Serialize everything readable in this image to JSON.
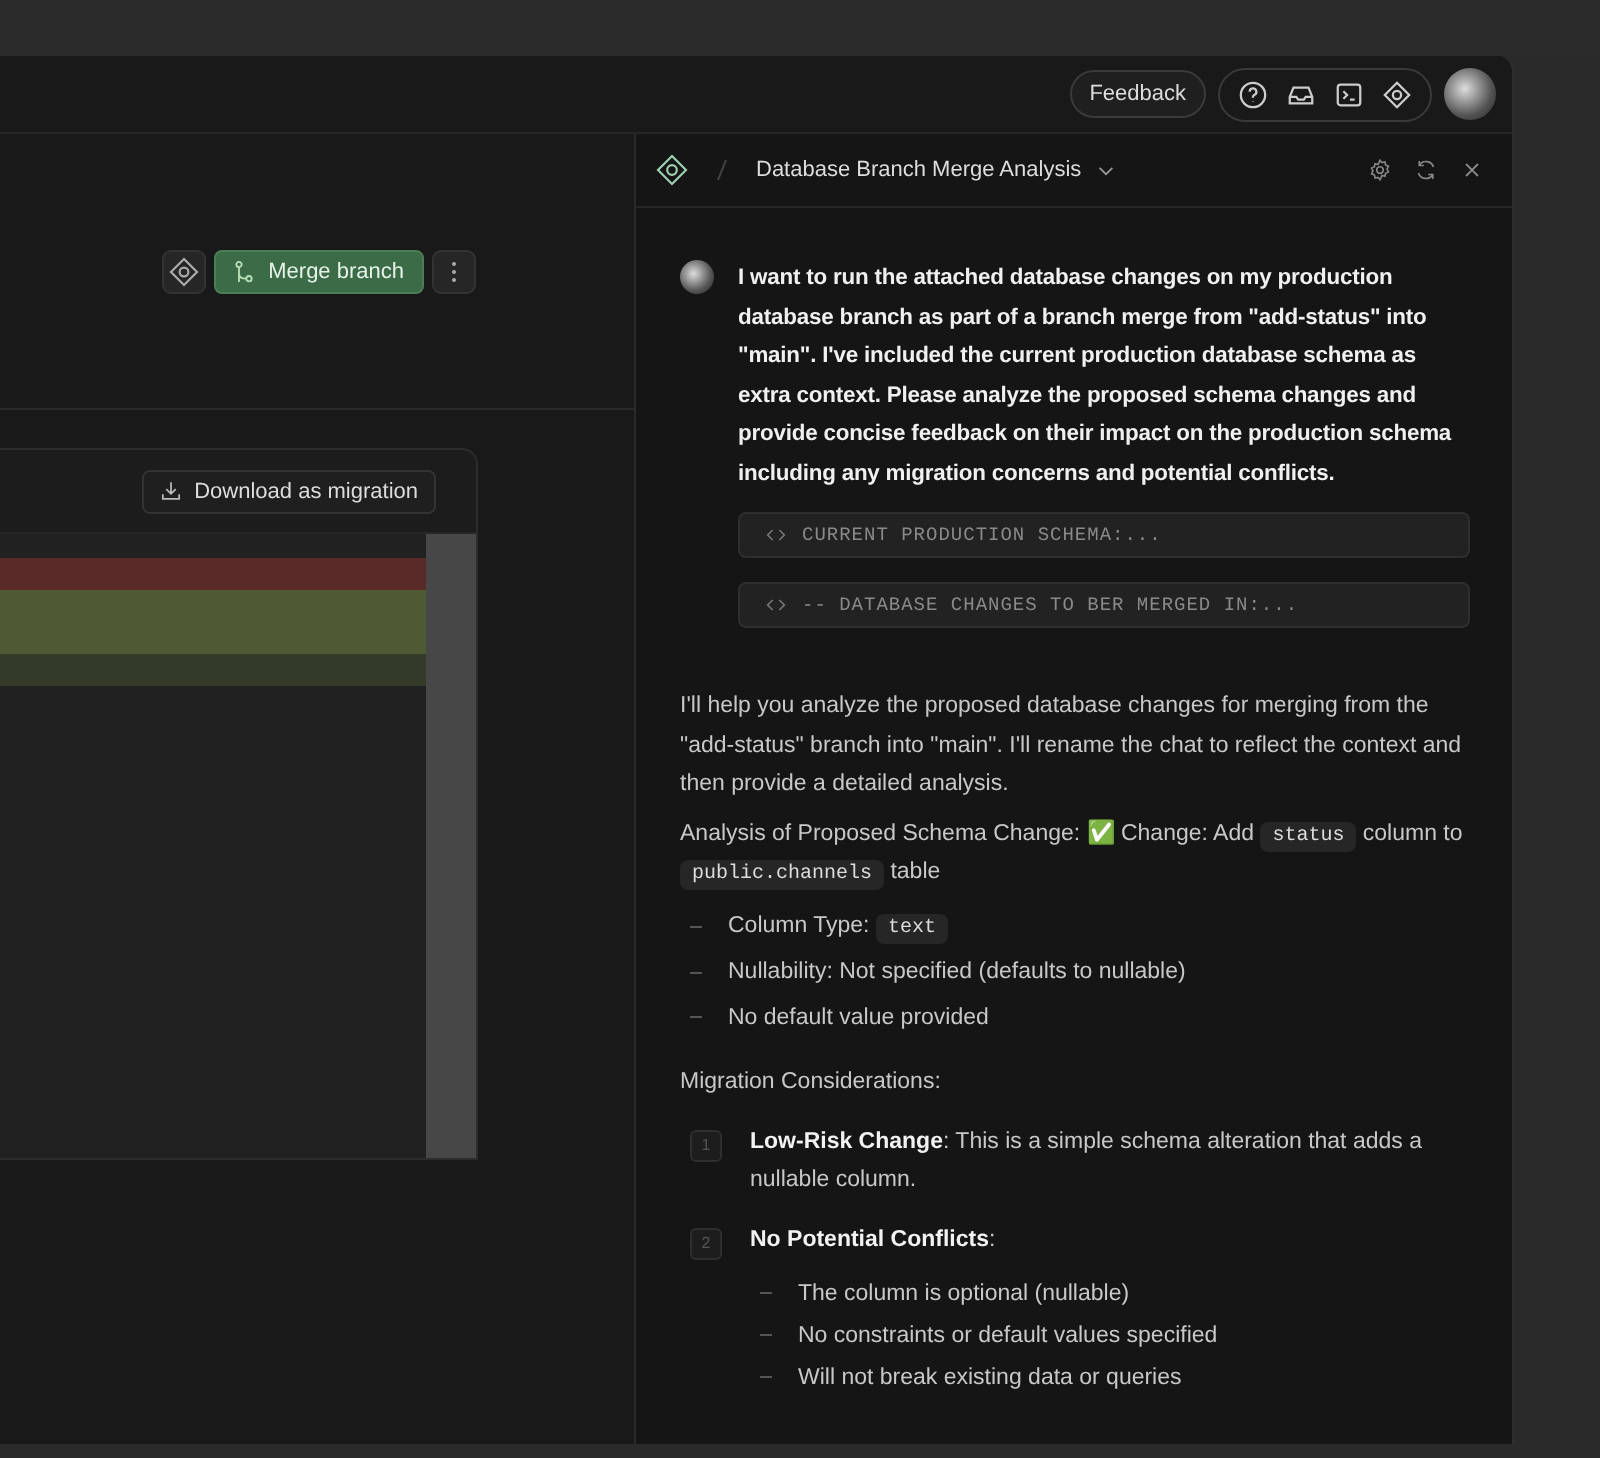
{
  "topbar": {
    "feedback_button": "Feedback"
  },
  "toolbar": {
    "merge_button": "Merge branch"
  },
  "diff_card": {
    "download_button": "Download as migration"
  },
  "chat": {
    "title": "Database Branch Merge Analysis",
    "user_message": {
      "text": "I want to run the attached database changes on my production database branch as part of a branch merge from \"add-status\" into \"main\". I've included the current production database schema as extra context. Please analyze the proposed schema changes and provide concise feedback on their impact on the production schema including any migration concerns and potential conflicts.",
      "attachments": [
        "CURRENT PRODUCTION SCHEMA:...",
        "-- DATABASE CHANGES TO BER MERGED IN:..."
      ]
    },
    "reply": {
      "intro": "I'll help you analyze the proposed database changes for merging from the \"add-status\" branch into \"main\". I'll rename the chat to reflect the context and then provide a detailed analysis.",
      "analysis": [
        {
          "kind": "text",
          "text": "Analysis of Proposed Schema Change: ✅ Change: Add "
        },
        {
          "kind": "code",
          "text": "status"
        },
        {
          "kind": "text",
          "text": " column to "
        },
        {
          "kind": "code",
          "text": "public.channels"
        },
        {
          "kind": "text",
          "text": " table"
        }
      ],
      "bullets": [
        [
          {
            "kind": "text",
            "text": "Column Type: "
          },
          {
            "kind": "code",
            "text": "text"
          }
        ],
        [
          {
            "kind": "text",
            "text": "Nullability: Not specified (defaults to nullable)"
          }
        ],
        [
          {
            "kind": "text",
            "text": "No default value provided"
          }
        ]
      ],
      "heading": "Migration Considerations:",
      "steps": [
        {
          "number": "1",
          "text": "**Low-Risk Change**: This is a simple schema alteration that adds a nullable column."
        },
        {
          "number": "2",
          "text": "**No Potential Conflicts**:",
          "children": [
            "The column is optional (nullable)",
            "No constraints or default values specified",
            "Will not break existing data or queries"
          ]
        }
      ]
    }
  }
}
